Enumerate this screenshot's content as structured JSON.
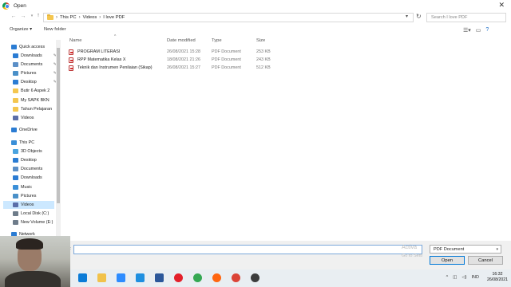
{
  "window": {
    "title": "Open",
    "close_glyph": "✕"
  },
  "address": {
    "crumbs": [
      "This PC",
      "Videos",
      "I love PDF"
    ],
    "search_placeholder": "Search I love PDF"
  },
  "toolbar": {
    "organize": "Organize ▾",
    "new_folder": "New folder"
  },
  "sidebar": {
    "items": [
      {
        "label": "Quick access",
        "icon": "star-icon",
        "color": "#2b7cd3"
      },
      {
        "label": "Downloads",
        "icon": "download-icon",
        "color": "#2b7cd3"
      },
      {
        "label": "Documents",
        "icon": "documents-icon",
        "color": "#5b8fc7"
      },
      {
        "label": "Pictures",
        "icon": "pictures-icon",
        "color": "#4a90c8"
      },
      {
        "label": "Desktop",
        "icon": "desktop-icon",
        "color": "#2b7cd3"
      },
      {
        "label": "Butir 6 Aspek 2",
        "icon": "folder-icon",
        "color": "#f4c64f"
      },
      {
        "label": "My SAPK BKN",
        "icon": "folder-icon",
        "color": "#f4c64f"
      },
      {
        "label": "Tahun Pelajaran",
        "icon": "folder-icon",
        "color": "#f4c64f"
      },
      {
        "label": "Videos",
        "icon": "videos-icon",
        "color": "#5b6ea8"
      },
      {
        "label": "OneDrive",
        "icon": "cloud-icon",
        "color": "#2b7cd3"
      },
      {
        "label": "This PC",
        "icon": "pc-icon",
        "color": "#3a8fd8"
      },
      {
        "label": "3D Objects",
        "icon": "cube-icon",
        "color": "#4aa3df"
      },
      {
        "label": "Desktop",
        "icon": "desktop-icon",
        "color": "#2b7cd3"
      },
      {
        "label": "Documents",
        "icon": "documents-icon",
        "color": "#5b8fc7"
      },
      {
        "label": "Downloads",
        "icon": "download-icon",
        "color": "#2b7cd3"
      },
      {
        "label": "Music",
        "icon": "music-icon",
        "color": "#3a8fd8"
      },
      {
        "label": "Pictures",
        "icon": "pictures-icon",
        "color": "#4a90c8"
      },
      {
        "label": "Videos",
        "icon": "videos-icon",
        "color": "#5b6ea8"
      },
      {
        "label": "Local Disk (C:)",
        "icon": "disk-icon",
        "color": "#6e7c8a"
      },
      {
        "label": "New Volume (E:)",
        "icon": "disk-icon",
        "color": "#6e7c8a"
      },
      {
        "label": "Network",
        "icon": "network-icon",
        "color": "#2b7cd3"
      }
    ],
    "selected_index": 17
  },
  "columns": {
    "name": "Name",
    "date": "Date modified",
    "type": "Type",
    "size": "Size"
  },
  "files": [
    {
      "name": "PROGRAM LITERASI",
      "date": "26/08/2021 15:28",
      "type": "PDF Document",
      "size": "253 KB"
    },
    {
      "name": "RPP Matematika Kelas X",
      "date": "18/08/2021 21:26",
      "type": "PDF Document",
      "size": "243 KB"
    },
    {
      "name": "Teknik dan Instrumen Penilaian (Sikap)",
      "date": "26/08/2021 15:27",
      "type": "PDF Document",
      "size": "512 KB"
    }
  ],
  "bottom": {
    "filename_label": "e:",
    "filename_value": "",
    "filetype": "PDF Document",
    "open_label": "Open",
    "cancel_label": "Cancel",
    "watermark_line1": "Activa",
    "watermark_line2": "Go to Setti"
  },
  "taskbar": {
    "time": "16:32",
    "date": "26/08/2021",
    "lang": "IND",
    "icons": [
      {
        "name": "edge-icon",
        "color": "#0a7bd7"
      },
      {
        "name": "explorer-icon",
        "color": "#f1c24b"
      },
      {
        "name": "zoom-icon",
        "color": "#2d8cff"
      },
      {
        "name": "ie-icon",
        "color": "#1e8fe0"
      },
      {
        "name": "word-icon",
        "color": "#2b579a"
      },
      {
        "name": "opera-icon",
        "color": "#e3202b"
      },
      {
        "name": "chrome-icon",
        "color": "#34a853"
      },
      {
        "name": "firefox-icon",
        "color": "#ff6611"
      },
      {
        "name": "chrome-active-icon",
        "color": "#db4437"
      },
      {
        "name": "obs-icon",
        "color": "#3c3c3c"
      }
    ]
  }
}
